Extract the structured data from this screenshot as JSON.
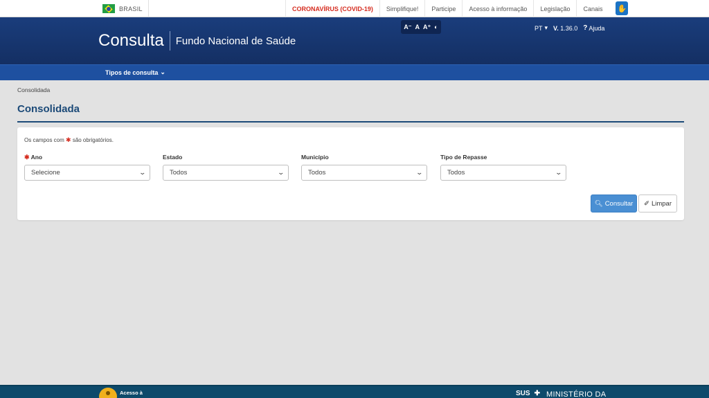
{
  "gov_bar": {
    "country": "BRASIL",
    "links": [
      "CORONAVÍRUS (COVID-19)",
      "Simplifique!",
      "Participe",
      "Acesso à informação",
      "Legislação",
      "Canais"
    ]
  },
  "header": {
    "app_title": "Consulta",
    "subtitle": "Fundo Nacional de Saúde",
    "accessibility": {
      "decrease": "A⁻",
      "normal": "A",
      "increase": "A⁺",
      "contrast": "◐"
    },
    "language": "PT",
    "version_prefix": "V.",
    "version": "1.36.0",
    "help": "Ajuda"
  },
  "nav": {
    "menu_label": "Tipos de consulta"
  },
  "breadcrumb": "Consolidada",
  "page_title": "Consolidada",
  "form": {
    "required_note_pre": "Os campos com",
    "required_note_post": "são obrigatórios.",
    "fields": [
      {
        "label": "Ano",
        "value": "Selecione",
        "required": true
      },
      {
        "label": "Estado",
        "value": "Todos"
      },
      {
        "label": "Município",
        "value": "Todos"
      },
      {
        "label": "Tipo de Repasse",
        "value": "Todos"
      }
    ],
    "consult_button": "Consultar",
    "clear_button": "Limpar"
  },
  "footer": {
    "left_label": "Acesso à",
    "sus_label": "SUS",
    "right_label": "MINISTÉRIO DA"
  },
  "colors": {
    "header_blue": "#1a3d7c",
    "nav_blue": "#1e50a0",
    "title_blue": "#1c4a78",
    "primary_button": "#4a8fd3",
    "covid_red": "#d52b1e",
    "footer_teal": "#0d4a6b"
  }
}
